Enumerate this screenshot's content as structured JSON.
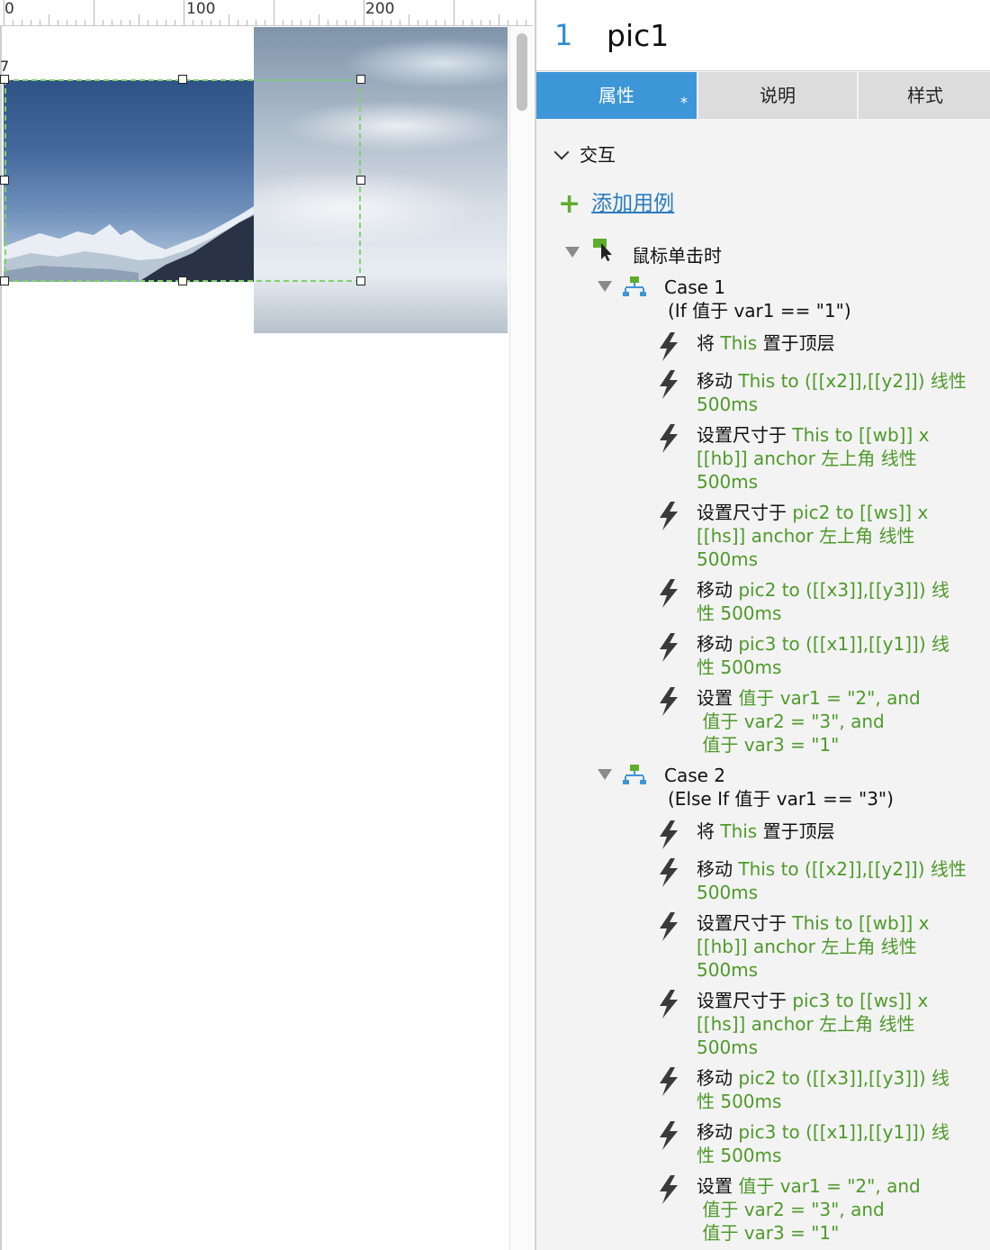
{
  "ruler": {
    "labels": [
      "0",
      "100",
      "200"
    ]
  },
  "canvas": {
    "note_marker": "7"
  },
  "inspector": {
    "page_number": "1",
    "widget_name": "pic1",
    "tabs": [
      {
        "label": "属性",
        "active": true,
        "mark": "*"
      },
      {
        "label": "说明",
        "active": false
      },
      {
        "label": "样式",
        "active": false
      }
    ],
    "section_title": "交互",
    "add_case_label": "添加用例",
    "event_label": "鼠标单击时",
    "cases": [
      {
        "title": "Case 1",
        "condition": "(If 值于 var1 == \"1\")",
        "actions": [
          {
            "segments": [
              [
                "将 ",
                "k"
              ],
              [
                "This",
                "g"
              ],
              [
                " 置于顶层",
                "k"
              ]
            ]
          },
          {
            "segments": [
              [
                "移动 ",
                "k"
              ],
              [
                "This to ([[x2]],[[y2]]) 线性 500ms",
                "g"
              ]
            ]
          },
          {
            "segments": [
              [
                "设置尺寸于 ",
                "k"
              ],
              [
                "This to [[wb]] x [[hb]] anchor 左上角 线性 500ms",
                "g"
              ]
            ]
          },
          {
            "segments": [
              [
                "设置尺寸于 ",
                "k"
              ],
              [
                "pic2 to [[ws]] x [[hs]] anchor 左上角 线性 500ms",
                "g"
              ]
            ]
          },
          {
            "segments": [
              [
                "移动 ",
                "k"
              ],
              [
                "pic2 to ([[x3]],[[y3]]) 线性 500ms",
                "g"
              ]
            ]
          },
          {
            "segments": [
              [
                "移动 ",
                "k"
              ],
              [
                "pic3 to ([[x1]],[[y1]]) 线性 500ms",
                "g"
              ]
            ]
          },
          {
            "segments": [
              [
                "设置 ",
                "k"
              ],
              [
                "值于 var1 = \"2\", and",
                "g"
              ],
              [
                "\n",
                "br"
              ],
              [
                "值于 var2 = \"3\", and",
                "g"
              ],
              [
                "\n",
                "br"
              ],
              [
                "值于 var3 = \"1\"",
                "g"
              ]
            ]
          }
        ]
      },
      {
        "title": "Case 2",
        "condition": "(Else If 值于 var1 == \"3\")",
        "actions": [
          {
            "segments": [
              [
                "将 ",
                "k"
              ],
              [
                "This",
                "g"
              ],
              [
                " 置于顶层",
                "k"
              ]
            ]
          },
          {
            "segments": [
              [
                "移动 ",
                "k"
              ],
              [
                "This to ([[x2]],[[y2]]) 线性 500ms",
                "g"
              ]
            ]
          },
          {
            "segments": [
              [
                "设置尺寸于 ",
                "k"
              ],
              [
                "This to [[wb]] x [[hb]] anchor 左上角 线性 500ms",
                "g"
              ]
            ]
          },
          {
            "segments": [
              [
                "设置尺寸于 ",
                "k"
              ],
              [
                "pic3 to [[ws]] x [[hs]] anchor 左上角 线性 500ms",
                "g"
              ]
            ]
          },
          {
            "segments": [
              [
                "移动 ",
                "k"
              ],
              [
                "pic2 to ([[x3]],[[y3]]) 线性 500ms",
                "g"
              ]
            ]
          },
          {
            "segments": [
              [
                "移动 ",
                "k"
              ],
              [
                "pic3 to ([[x1]],[[y1]]) 线性 500ms",
                "g"
              ]
            ]
          },
          {
            "segments": [
              [
                "设置 ",
                "k"
              ],
              [
                "值于 var1 = \"2\", and",
                "g"
              ],
              [
                "\n",
                "br"
              ],
              [
                "值于 var2 = \"3\", and",
                "g"
              ],
              [
                "\n",
                "br"
              ],
              [
                "值于 var3 = \"1\"",
                "g"
              ]
            ]
          }
        ]
      }
    ]
  },
  "colors": {
    "accent": "#3d96d8",
    "action_green": "#4e9a2a",
    "add_plus": "#5fad2b",
    "selection": "#7fd36b"
  },
  "icons": [
    "chevron-down-icon",
    "plus-icon",
    "expand-triangle-icon",
    "click-event-icon",
    "case-icon",
    "lightning-bolt-icon"
  ]
}
